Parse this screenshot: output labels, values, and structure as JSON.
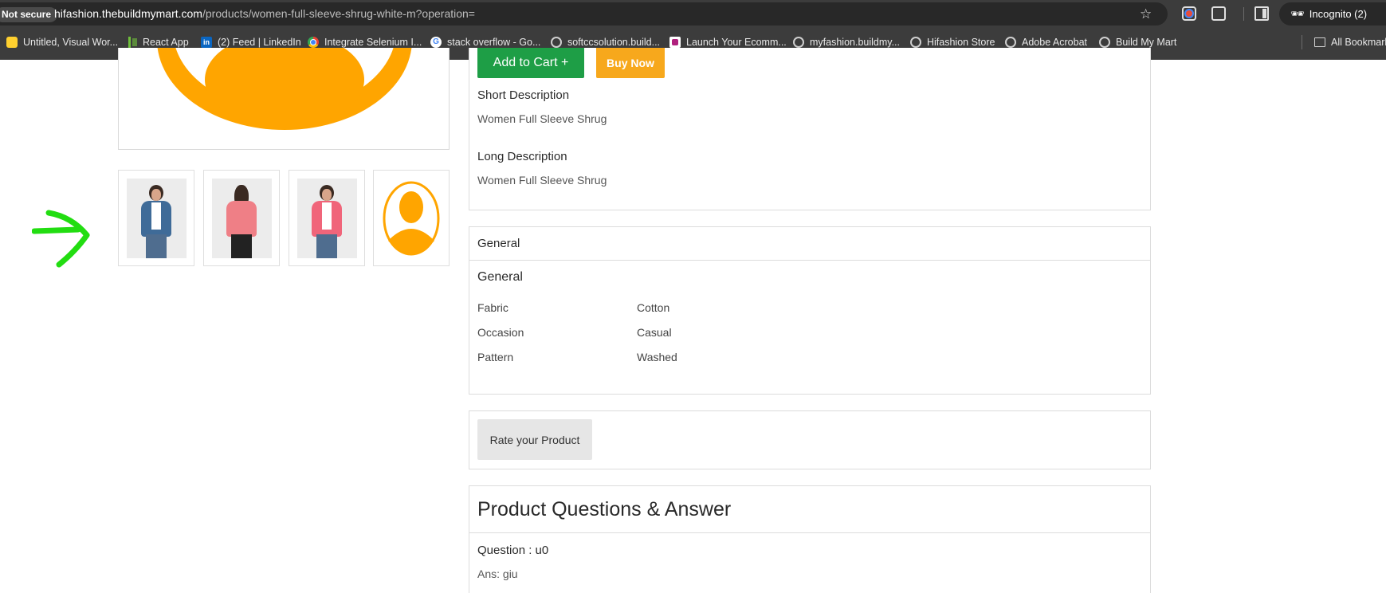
{
  "browser": {
    "security_label": "Not secure",
    "url_host": "hifashion.thebuildmymart.com",
    "url_path": "/products/women-full-sleeve-shrug-white-m?operation=",
    "incognito_label": "Incognito (2)",
    "bookmarks": [
      {
        "label": "Untitled, Visual Wor...",
        "icon": "miro-icon"
      },
      {
        "label": "React App",
        "icon": "react-app-icon"
      },
      {
        "label": "(2) Feed | LinkedIn",
        "icon": "linkedin-icon"
      },
      {
        "label": "Integrate Selenium I...",
        "icon": "chrome-icon"
      },
      {
        "label": "stack overflow - Go...",
        "icon": "google-icon"
      },
      {
        "label": "softccsolution.build...",
        "icon": "globe-icon"
      },
      {
        "label": "Launch Your Ecomm...",
        "icon": "launch-icon"
      },
      {
        "label": "myfashion.buildmy...",
        "icon": "globe-icon"
      },
      {
        "label": "Hifashion Store",
        "icon": "globe-icon"
      },
      {
        "label": "Adobe Acrobat",
        "icon": "globe-icon"
      },
      {
        "label": "Build My Mart",
        "icon": "globe-icon"
      }
    ],
    "all_bookmarks_label": "All Bookmarks"
  },
  "product": {
    "add_to_cart_label": "Add to Cart +",
    "buy_now_label": "Buy Now",
    "short_desc_heading": "Short Description",
    "short_desc": "Women Full Sleeve Shrug",
    "long_desc_heading": "Long Description",
    "long_desc": "Women Full Sleeve Shrug",
    "thumbnails": [
      "denim-shrug-front",
      "pink-shrug-back",
      "pink-shrug-front",
      "placeholder-avatar"
    ]
  },
  "specs": {
    "card_title": "General",
    "group_title": "General",
    "rows": [
      {
        "key": "Fabric",
        "value": "Cotton"
      },
      {
        "key": "Occasion",
        "value": "Casual"
      },
      {
        "key": "Pattern",
        "value": "Washed"
      }
    ]
  },
  "rating": {
    "button_label": "Rate your Product"
  },
  "qa": {
    "title": "Product Questions & Answer",
    "question": "Question : u0",
    "answer": "Ans: giu"
  },
  "colors": {
    "accent_orange": "#ffa500",
    "cart_green": "#1e9e46",
    "buy_yellow": "#f7a81c",
    "annotation_green": "#22dd11"
  }
}
